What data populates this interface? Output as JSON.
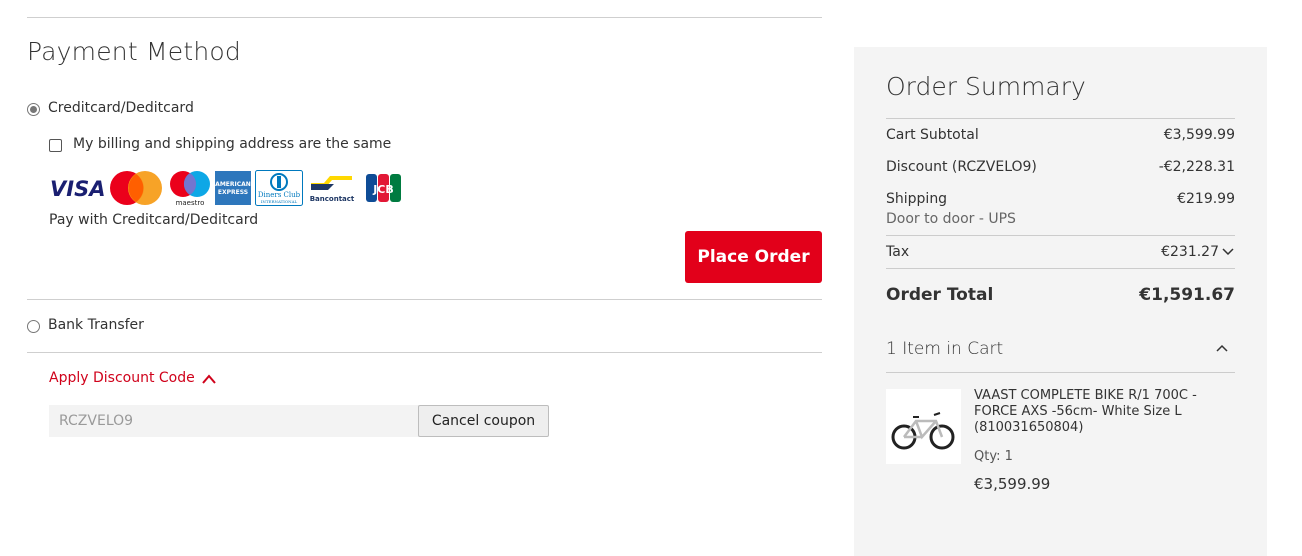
{
  "payment": {
    "title": "Payment Method",
    "option_card_label": "Creditcard/Deditcard",
    "same_address_label": "My billing and shipping address are the same",
    "pay_with_text": "Pay with Creditcard/Deditcard",
    "place_order_label": "Place Order",
    "option_bank_label": "Bank Transfer",
    "card_logos": {
      "visa": "VISA",
      "maestro": "maestro",
      "amex_line1": "AMERICAN",
      "amex_line2": "EXPRESS",
      "diners_line1": "Diners Club",
      "diners_line2": "INTERNATIONAL",
      "bancontact": "Bancontact",
      "jcb": "JCB"
    }
  },
  "discount": {
    "link_label": "Apply Discount Code",
    "input_value": "RCZVELO9",
    "cancel_label": "Cancel coupon"
  },
  "summary": {
    "title": "Order Summary",
    "subtotal_label": "Cart Subtotal",
    "subtotal_value": "€3,599.99",
    "discount_label": "Discount (RCZVELO9)",
    "discount_value": "-€2,228.31",
    "shipping_label": "Shipping",
    "shipping_value": "€219.99",
    "shipping_method": "Door to door - UPS",
    "tax_label": "Tax",
    "tax_value": "€231.27",
    "total_label": "Order Total",
    "total_value": "€1,591.67",
    "items_label": "1 Item in Cart",
    "product": {
      "name": "VAAST COMPLETE BIKE R/1 700C - FORCE AXS -56cm- White Size L (810031650804)",
      "qty": "Qty: 1",
      "price": "€3,599.99"
    }
  },
  "colors": {
    "accent_red": "#e2001a",
    "link_red": "#d0021b",
    "summary_bg": "#f4f4f4"
  }
}
